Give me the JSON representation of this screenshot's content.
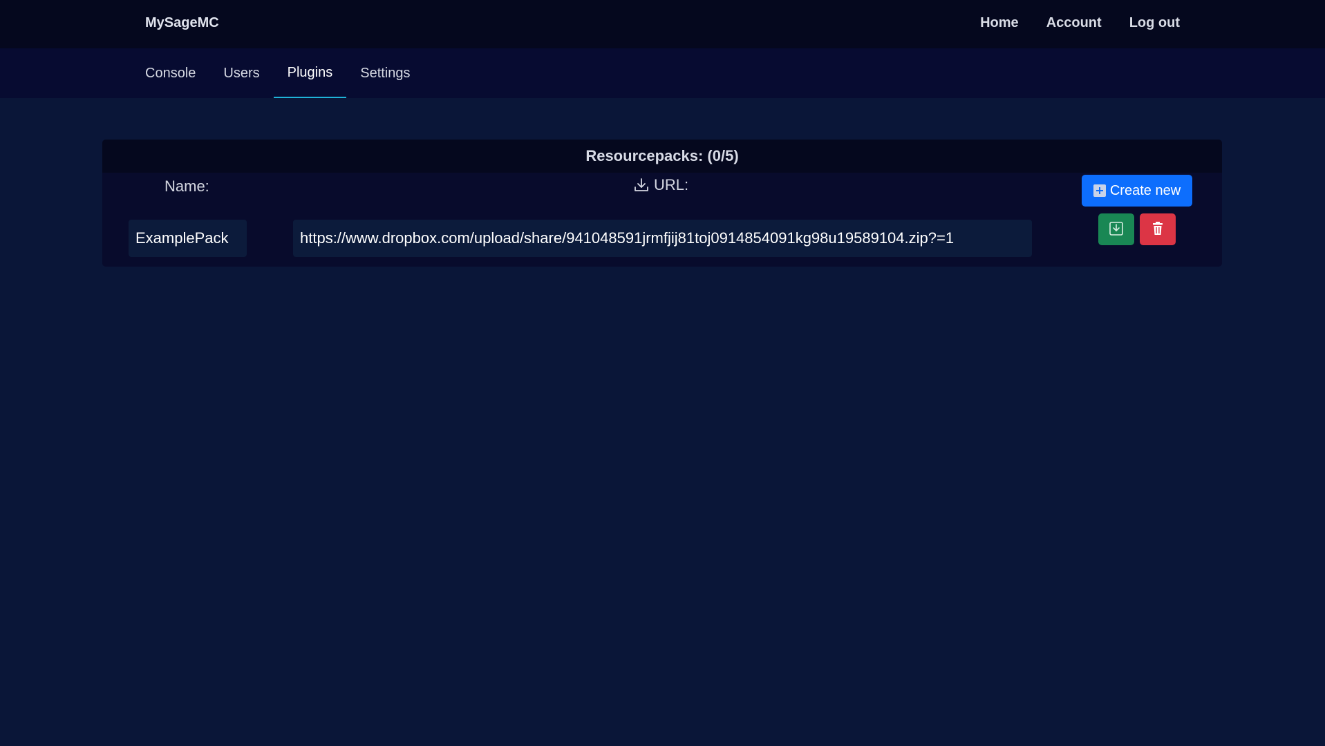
{
  "header": {
    "brand": "MySageMC",
    "nav": {
      "home": "Home",
      "account": "Account",
      "logout": "Log out"
    }
  },
  "tabs": {
    "console": "Console",
    "users": "Users",
    "plugins": "Plugins",
    "settings": "Settings",
    "active": "Plugins"
  },
  "panel": {
    "title": "Resourcepacks: (0/5)",
    "name_label": "Name:",
    "url_label": "URL:",
    "create_label": "Create new",
    "row": {
      "name_value": "ExamplePack",
      "url_value": "https://www.dropbox.com/upload/share/941048591jrmfjij81toj0914854091kg98u19589104.zip?=1"
    }
  },
  "colors": {
    "background": "#0a1638",
    "topbar": "#05081e",
    "subnav": "#070b31",
    "accent_underline": "#1fb2d8",
    "create_button": "#0d6efd",
    "download_button": "#198754",
    "delete_button": "#dc3545"
  },
  "icons": {
    "create": "plus-square-icon",
    "url_header": "download-icon",
    "row_download": "download-box-icon",
    "row_delete": "trash-icon"
  }
}
